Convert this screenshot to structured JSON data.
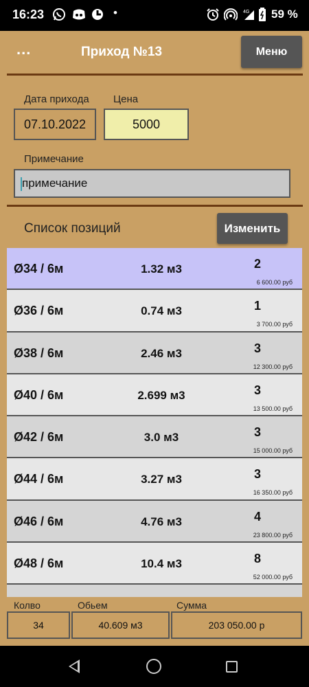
{
  "status_bar": {
    "time": "16:23",
    "icons_left": [
      "whatsapp-icon",
      "discord-icon",
      "app-icon",
      "dot-icon"
    ],
    "icons_right": [
      "alarm-icon",
      "hotspot-icon",
      "signal-4g-icon",
      "battery-icon"
    ],
    "network": "4G",
    "battery": "59 %"
  },
  "toolbar": {
    "more_label": "...",
    "title": "Приход №13",
    "menu_label": "Меню"
  },
  "form": {
    "date_label": "Дата прихода",
    "date_value": "07.10.2022",
    "price_label": "Цена",
    "price_value": "5000",
    "note_label": "Примечание",
    "note_value": "примечание"
  },
  "list": {
    "title": "Список позиций",
    "change_label": "Изменить",
    "rows": [
      {
        "name": "Ø34 / 6м",
        "volume": "1.32 м3",
        "qty": "2",
        "sum": "6 600.00 руб"
      },
      {
        "name": "Ø36 / 6м",
        "volume": "0.74 м3",
        "qty": "1",
        "sum": "3 700.00 руб"
      },
      {
        "name": "Ø38 / 6м",
        "volume": "2.46 м3",
        "qty": "3",
        "sum": "12 300.00 руб"
      },
      {
        "name": "Ø40 / 6м",
        "volume": "2.699 м3",
        "qty": "3",
        "sum": "13 500.00 руб"
      },
      {
        "name": "Ø42 / 6м",
        "volume": "3.0 м3",
        "qty": "3",
        "sum": "15 000.00 руб"
      },
      {
        "name": "Ø44 / 6м",
        "volume": "3.27 м3",
        "qty": "3",
        "sum": "16 350.00 руб"
      },
      {
        "name": "Ø46 / 6м",
        "volume": "4.76 м3",
        "qty": "4",
        "sum": "23 800.00 руб"
      },
      {
        "name": "Ø48 / 6м",
        "volume": "10.4 м3",
        "qty": "8",
        "sum": "52 000.00 руб"
      },
      {
        "name": "",
        "volume": "",
        "qty": "",
        "sum": ""
      }
    ]
  },
  "footer": {
    "count_label": "Колво",
    "count_value": "34",
    "volume_label": "Обьем",
    "volume_value": "40.609 м3",
    "sum_label": "Сумма",
    "sum_value": "203 050.00 р"
  },
  "colors": {
    "background": "#c9a064",
    "divider": "#6b3a12",
    "button": "#555555",
    "selected_row": "#c7c3f8",
    "price_field": "#f0eeaa"
  }
}
